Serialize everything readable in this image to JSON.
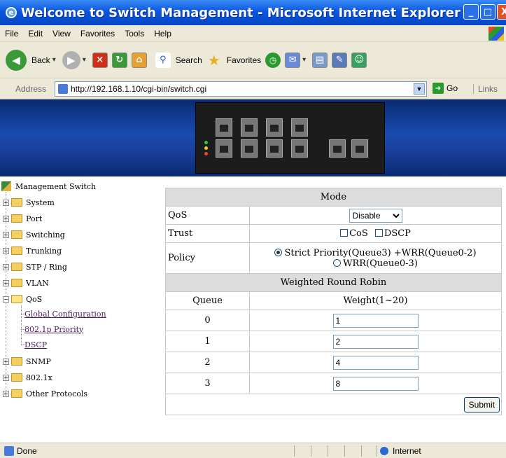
{
  "window": {
    "title": "Welcome to Switch Management - Microsoft Internet Explorer",
    "min": "_",
    "max": "□",
    "close": "X"
  },
  "menu": [
    "File",
    "Edit",
    "View",
    "Favorites",
    "Tools",
    "Help"
  ],
  "toolbar": {
    "back": "Back",
    "search": "Search",
    "favorites": "Favorites"
  },
  "address": {
    "label": "Address",
    "url": "http://192.168.1.10/cgi-bin/switch.cgi",
    "go": "Go",
    "links": "Links"
  },
  "sidebar": {
    "root": "Management Switch",
    "items": [
      "System",
      "Port",
      "Switching",
      "Trunking",
      "STP / Ring",
      "VLAN",
      "QoS",
      "SNMP",
      "802.1x",
      "Other Protocols"
    ],
    "qos_children": [
      "Global Configuration",
      "802.1p Priority",
      "DSCP"
    ]
  },
  "form": {
    "mode_header": "Mode",
    "qos_label": "QoS",
    "qos_value": "Disable",
    "trust_label": "Trust",
    "trust_cos": "CoS",
    "trust_dscp": "DSCP",
    "policy_label": "Policy",
    "policy_opt1": "Strict Priority(Queue3) +WRR(Queue0-2)",
    "policy_opt2": "WRR(Queue0-3)",
    "wrr_header": "Weighted Round Robin",
    "queue_col": "Queue",
    "weight_col": "Weight(1~20)",
    "queues": [
      {
        "q": "0",
        "w": "1"
      },
      {
        "q": "1",
        "w": "2"
      },
      {
        "q": "2",
        "w": "4"
      },
      {
        "q": "3",
        "w": "8"
      }
    ],
    "submit": "Submit"
  },
  "status": {
    "text": "Done",
    "zone": "Internet"
  }
}
